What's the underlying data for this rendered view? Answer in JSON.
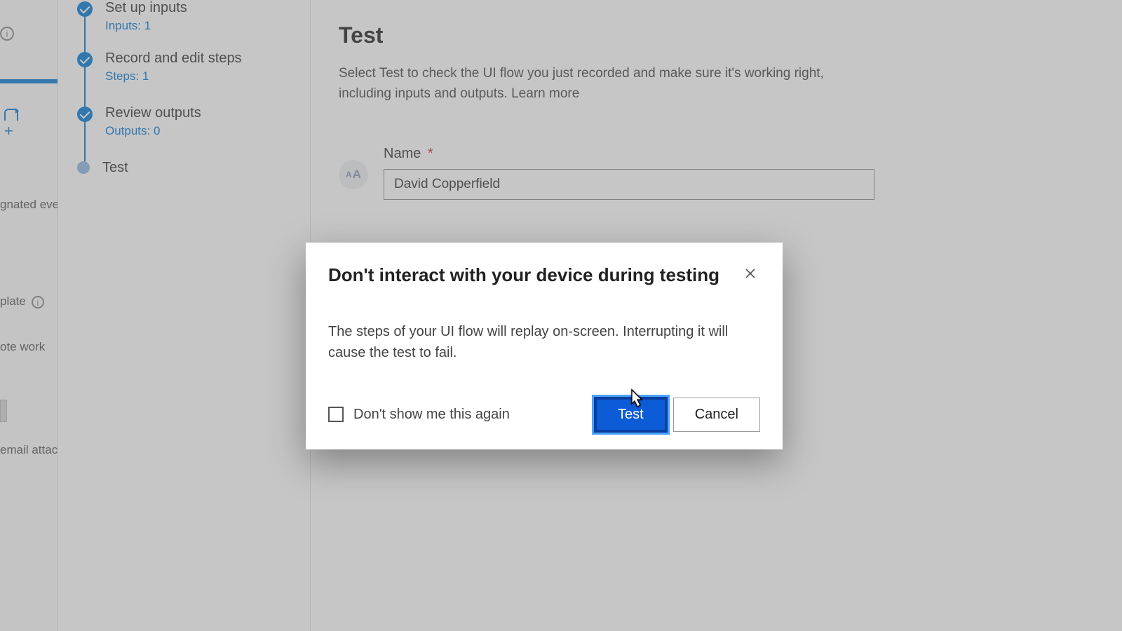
{
  "leftStrip": {
    "cut1": "gnated even",
    "cut2": "plate",
    "cut3": "ote work",
    "cut4": "email attac"
  },
  "steps": [
    {
      "title": "Set up inputs",
      "sub": "Inputs: 1",
      "state": "check"
    },
    {
      "title": "Record and edit steps",
      "sub": "Steps: 1",
      "state": "check"
    },
    {
      "title": "Review outputs",
      "sub": "Outputs: 0",
      "state": "check"
    },
    {
      "title": "Test",
      "sub": "",
      "state": "current"
    }
  ],
  "main": {
    "heading": "Test",
    "description": "Select Test to check the UI flow you just recorded and make sure it's working right, including inputs and outputs. Learn more",
    "nameLabel": "Name",
    "nameRequired": "*",
    "nameValue": "David Copperfield"
  },
  "modal": {
    "title": "Don't interact with your device during testing",
    "body": "The steps of your UI flow will replay on-screen. Interrupting it will cause the test to fail.",
    "dontShow": "Don't show me this again",
    "primary": "Test",
    "secondary": "Cancel"
  }
}
